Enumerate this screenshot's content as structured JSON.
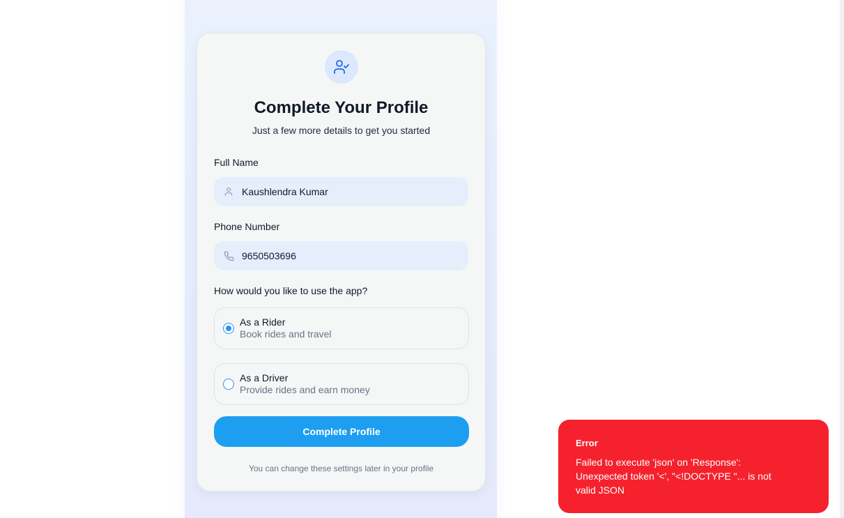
{
  "profile_form": {
    "title": "Complete Your Profile",
    "subtitle": "Just a few more details to get you started",
    "full_name": {
      "label": "Full Name",
      "value": "Kaushlendra Kumar",
      "icon": "user-icon"
    },
    "phone": {
      "label": "Phone Number",
      "value": "9650503696",
      "icon": "phone-icon"
    },
    "usage_question": "How would you like to use the app?",
    "options": [
      {
        "title": "As a Rider",
        "description": "Book rides and travel",
        "selected": true
      },
      {
        "title": "As a Driver",
        "description": "Provide rides and earn money",
        "selected": false
      }
    ],
    "submit_label": "Complete Profile",
    "footer_note": "You can change these settings later in your profile"
  },
  "toast": {
    "title": "Error",
    "message": "Failed to execute 'json' on 'Response': Unexpected token '<', \"<!DOCTYPE \"... is not valid JSON"
  },
  "colors": {
    "accent": "#1e9ef0",
    "error": "#f5222d",
    "avatar_bg": "#dbe8fd",
    "input_bg": "#e6eefc"
  }
}
